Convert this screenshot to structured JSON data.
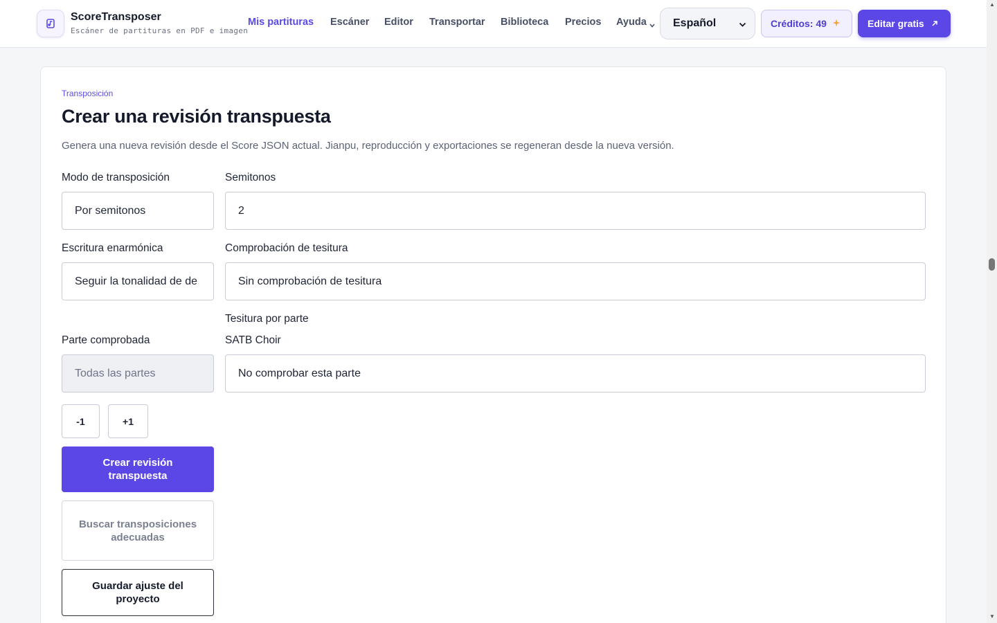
{
  "header": {
    "brand_name": "ScoreTransposer",
    "brand_tagline": "Escáner de partituras en PDF e imagen",
    "nav": [
      {
        "label": "Mis partituras"
      },
      {
        "label": "Escáner"
      },
      {
        "label": "Editor"
      },
      {
        "label": "Transportar"
      },
      {
        "label": "Biblioteca"
      },
      {
        "label": "Precios"
      },
      {
        "label": "Ayuda"
      }
    ],
    "language": "Español",
    "credits": "Créditos: 49",
    "cta": "Editar gratis"
  },
  "card": {
    "eyebrow": "Transposición",
    "title": "Crear una revisión transpuesta",
    "description": "Genera una nueva revisión desde el Score JSON actual. Jianpu, reproducción y exportaciones se regeneran desde la nueva versión.",
    "fields": {
      "mode_label": "Modo de transposición",
      "mode_value": "Por semitonos",
      "semitones_label": "Semitonos",
      "semitones_value": "2",
      "enharmonic_label": "Escritura enarmónica",
      "enharmonic_value": "Seguir la tonalidad de de",
      "range_check_label": "Comprobación de tesitura",
      "range_check_value": "Sin comprobación de tesitura",
      "range_per_part_label": "Tesitura por parte",
      "checked_part_label": "Parte comprobada",
      "checked_part_value": "Todas las partes",
      "part_name": "SATB Choir",
      "part_value": "No comprobar esta parte"
    },
    "steppers": {
      "minus": "-1",
      "plus": "+1"
    },
    "buttons": {
      "create": "Crear revisión transpuesta",
      "find": "Buscar transposiciones adecuadas",
      "save": "Guardar ajuste del proyecto"
    }
  },
  "colors": {
    "accent": "#5b47e6",
    "accent_text": "#5a4ae3",
    "sparkle": "#f2a23a"
  }
}
